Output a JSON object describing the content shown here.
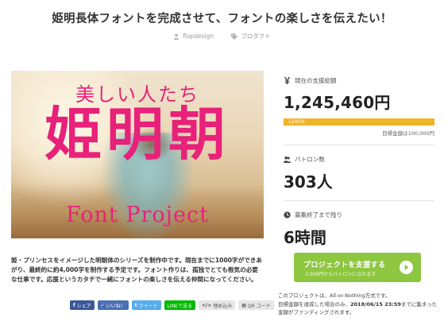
{
  "header": {
    "title": "姫明長体フォントを完成させて、フォントの楽しさを伝えたい！",
    "author": "flopdesign",
    "category": "プロダクト"
  },
  "hero": {
    "subtitle": "美しい人たち",
    "main_text": "姫明朝",
    "project_text": "Font Project"
  },
  "stats": {
    "funding_label": "現在の支援総額",
    "funding_amount": "1,245,460円",
    "progress_percent_text": "1245%",
    "progress_fraction": 1.0,
    "target_text": "目標金額は100,000円",
    "patrons_label": "パトロン数",
    "patrons_count": "303人",
    "time_label": "募集終了まで残り",
    "time_left": "6時間"
  },
  "cta": {
    "title": "プロジェクトを支援する",
    "subtitle": "3,000円からパトロンになれます"
  },
  "fine_print": {
    "line1": "このプロジェクトは、All-or-Nothing方式です。",
    "line2_prefix": "目標金額を達成した場合のみ、",
    "deadline": "2018/06/15 23:59",
    "line2_suffix": "までに集まった",
    "line3": "金額がファンディングされます。"
  },
  "description": "姫・プリンセスをイメージした明朝体のシリーズを制作中です。現在までに1000字ができあがり、最終的に約4,000字を制作する予定です。フォント作りは、孤独でとても根気の必要な仕事です。応援というカタチで一緒にフォントの楽しさを伝える仲間になってください。",
  "share": {
    "facebook": "シェア",
    "like": "いいね！",
    "tweet": "ツイート",
    "line": "LINEで送る",
    "embed": "埋め込み",
    "qr": "QR コード"
  },
  "colors": {
    "brand_pink": "#e8217a",
    "cta_green": "#8dc63f",
    "progress_yellow": "#f0b429"
  }
}
